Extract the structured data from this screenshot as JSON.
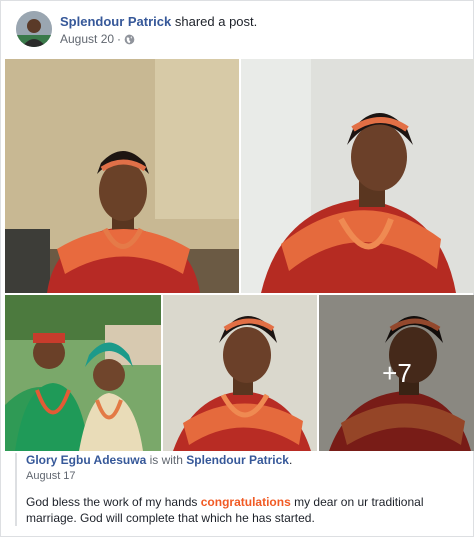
{
  "post": {
    "author": "Splendour Patrick",
    "action": "shared a post.",
    "date": "August 20",
    "date_separator": "·",
    "privacy_icon": "globe-icon",
    "more_photos": "+7"
  },
  "shared_post": {
    "author": "Glory Egbu Adesuwa",
    "with_text": "is with",
    "with_person": "Splendour Patrick",
    "end_punct": ".",
    "date": "August 17",
    "text_before": "God bless the work of my hands ",
    "highlight": "congratulations",
    "text_after": " my dear on ur traditional marriage. God will complete that which he has started."
  },
  "colors": {
    "link": "#365899",
    "text": "#1d2129",
    "muted": "#616770",
    "highlight": "#f15a24",
    "border": "#dddfe2"
  }
}
